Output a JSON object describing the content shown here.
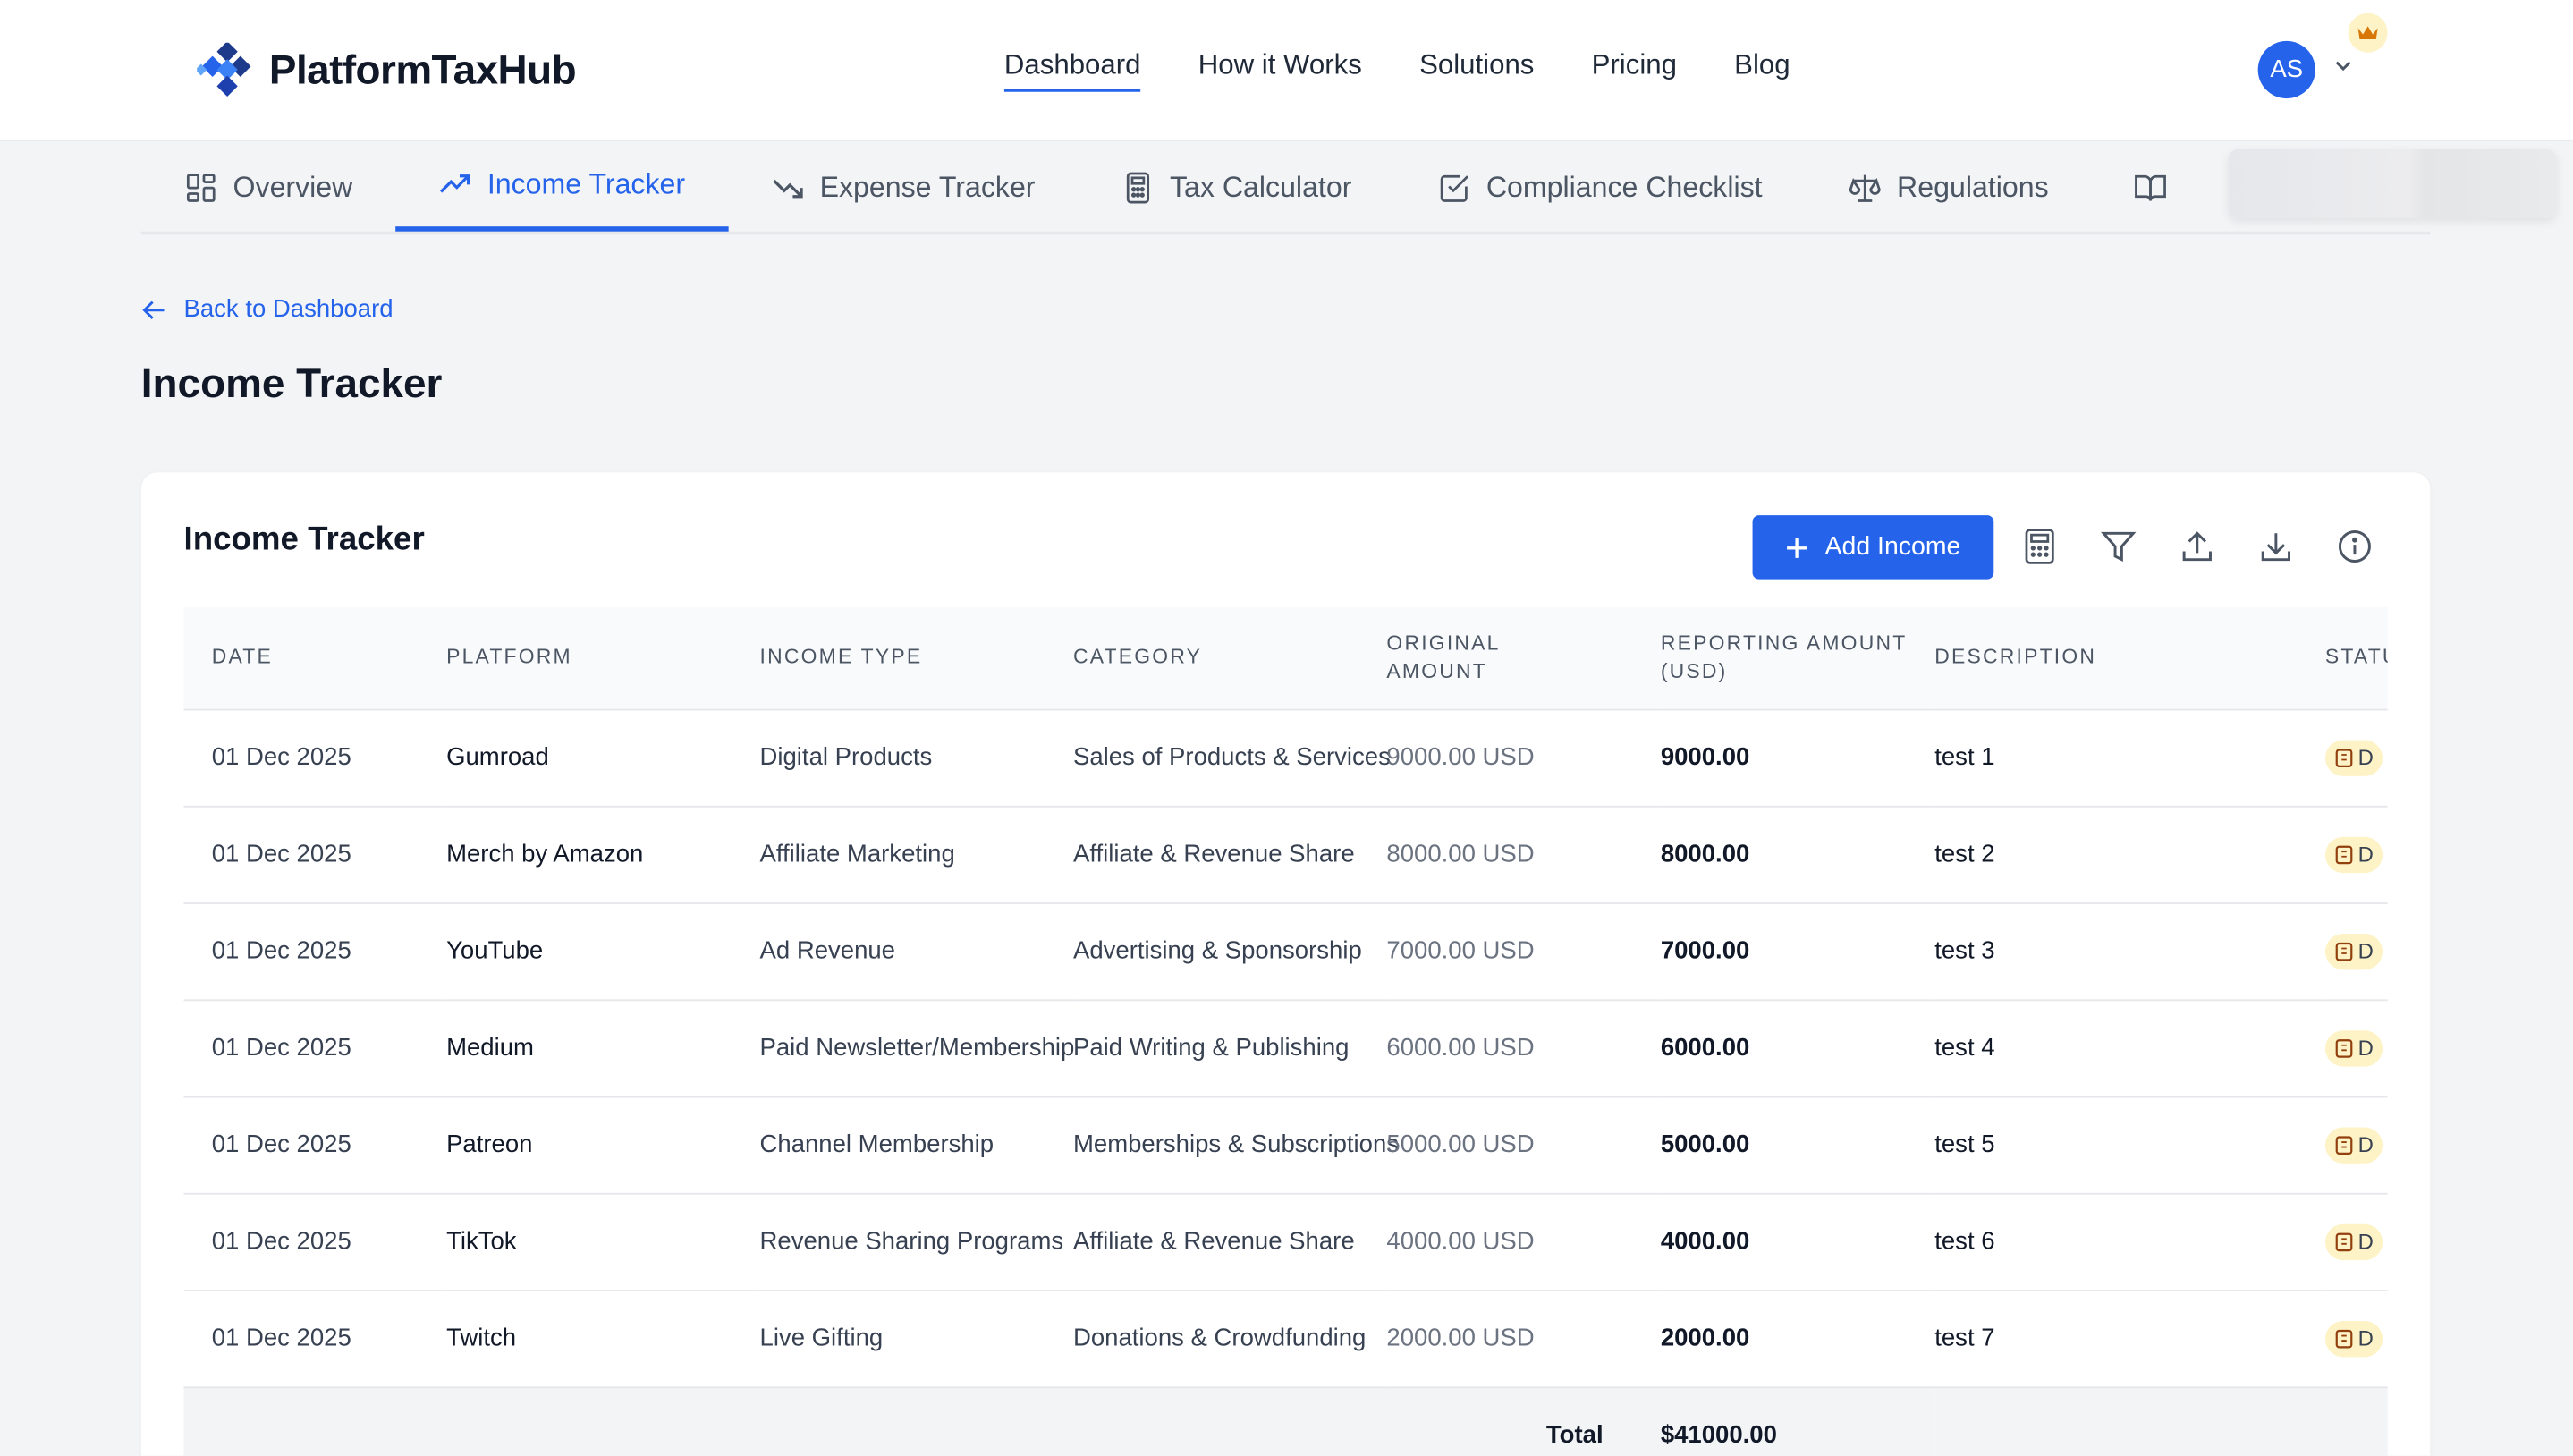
{
  "brand": {
    "name": "PlatformTaxHub"
  },
  "mainnav": [
    {
      "label": "Dashboard",
      "active": true
    },
    {
      "label": "How it Works"
    },
    {
      "label": "Solutions"
    },
    {
      "label": "Pricing"
    },
    {
      "label": "Blog"
    }
  ],
  "user": {
    "initials": "AS"
  },
  "tabs": [
    {
      "label": "Overview",
      "icon": "grid-icon"
    },
    {
      "label": "Income Tracker",
      "icon": "trending-up-icon",
      "active": true
    },
    {
      "label": "Expense Tracker",
      "icon": "trending-down-icon"
    },
    {
      "label": "Tax Calculator",
      "icon": "calculator-icon"
    },
    {
      "label": "Compliance Checklist",
      "icon": "checkbox-icon"
    },
    {
      "label": "Regulations",
      "icon": "scale-icon"
    }
  ],
  "back_label": "Back to Dashboard",
  "page_title": "Income Tracker",
  "card": {
    "title": "Income Tracker",
    "add_label": "Add Income"
  },
  "table": {
    "columns": [
      "Date",
      "Platform",
      "Income Type",
      "Category",
      "Original Amount",
      "Reporting Amount (USD)",
      "Description",
      "Statu"
    ],
    "rows": [
      {
        "date": "01 Dec 2025",
        "platform": "Gumroad",
        "type": "Digital Products",
        "category": "Sales of Products & Services",
        "original": "9000.00 USD",
        "reporting": "9000.00",
        "description": "test 1",
        "status": "D"
      },
      {
        "date": "01 Dec 2025",
        "platform": "Merch by Amazon",
        "type": "Affiliate Marketing",
        "category": "Affiliate & Revenue Share",
        "original": "8000.00 USD",
        "reporting": "8000.00",
        "description": "test 2",
        "status": "D"
      },
      {
        "date": "01 Dec 2025",
        "platform": "YouTube",
        "type": "Ad Revenue",
        "category": "Advertising & Sponsorship",
        "original": "7000.00 USD",
        "reporting": "7000.00",
        "description": "test 3",
        "status": "D"
      },
      {
        "date": "01 Dec 2025",
        "platform": "Medium",
        "type": "Paid Newsletter/Membership",
        "category": "Paid Writing & Publishing",
        "original": "6000.00 USD",
        "reporting": "6000.00",
        "description": "test 4",
        "status": "D"
      },
      {
        "date": "01 Dec 2025",
        "platform": "Patreon",
        "type": "Channel Membership",
        "category": "Memberships & Subscriptions",
        "original": "5000.00 USD",
        "reporting": "5000.00",
        "description": "test 5",
        "status": "D"
      },
      {
        "date": "01 Dec 2025",
        "platform": "TikTok",
        "type": "Revenue Sharing Programs",
        "category": "Affiliate & Revenue Share",
        "original": "4000.00 USD",
        "reporting": "4000.00",
        "description": "test 6",
        "status": "D"
      },
      {
        "date": "01 Dec 2025",
        "platform": "Twitch",
        "type": "Live Gifting",
        "category": "Donations & Crowdfunding",
        "original": "2000.00 USD",
        "reporting": "2000.00",
        "description": "test 7",
        "status": "D"
      }
    ],
    "total_label": "Total",
    "total_value": "$41000.00"
  },
  "colors": {
    "accent": "#2563eb",
    "badge_bg": "#fef3c7"
  }
}
